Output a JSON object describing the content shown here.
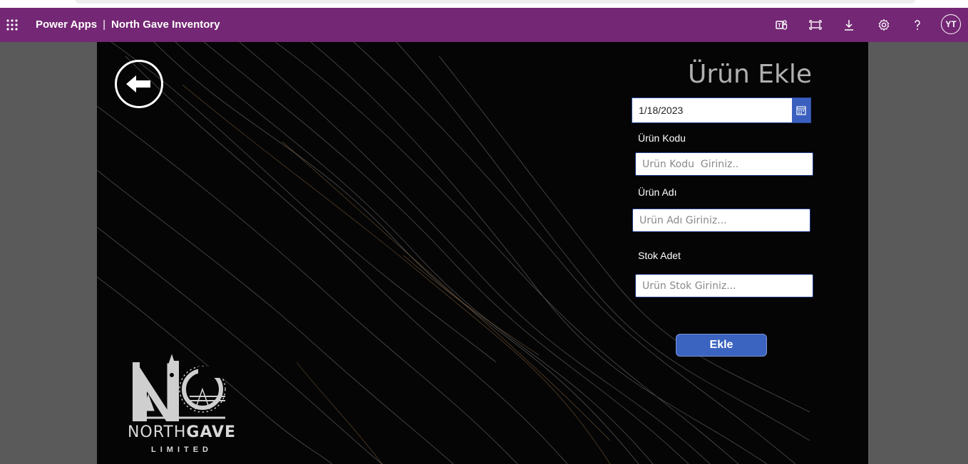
{
  "header": {
    "app_name": "Power Apps",
    "separator": "|",
    "app_title": "North Gave Inventory",
    "avatar_initials": "YT",
    "icons": [
      "app-launcher-icon",
      "teams-icon",
      "fit-screen-icon",
      "download-icon",
      "settings-icon",
      "help-icon"
    ],
    "color": "#742774"
  },
  "form": {
    "title": "Ürün Ekle",
    "date_value": "1/18/2023",
    "product_code_label": "Ürün Kodu",
    "product_code_placeholder": "Ürün Kodu  Giriniz..",
    "product_name_label": "Ürün Adı",
    "product_name_placeholder": "Ürün Adı Giriniz...",
    "stock_label": "Stok Adet",
    "stock_placeholder": "Ürün Stok Giriniz...",
    "submit_label": "Ekle",
    "accent_color": "#3b63c0"
  },
  "logo": {
    "brand_light": "NORTH",
    "brand_bold": "GAVE",
    "subtitle": "LIMITED"
  }
}
